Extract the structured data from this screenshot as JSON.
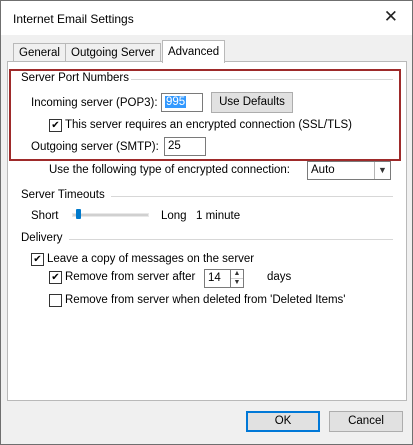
{
  "window": {
    "title": "Internet Email Settings"
  },
  "tabs": [
    {
      "label": "General"
    },
    {
      "label": "Outgoing Server"
    },
    {
      "label": "Advanced"
    }
  ],
  "server_ports": {
    "heading": "Server Port Numbers",
    "incoming_label": "Incoming server (POP3):",
    "incoming_value": "995",
    "use_defaults_label": "Use Defaults",
    "ssl_checkbox_label": "This server requires an encrypted connection (SSL/TLS)",
    "ssl_checked": true,
    "outgoing_label": "Outgoing server (SMTP):",
    "outgoing_value": "25",
    "encryption_label": "Use the following type of encrypted connection:",
    "encryption_value": "Auto"
  },
  "timeouts": {
    "heading": "Server Timeouts",
    "short_label": "Short",
    "long_label": "Long",
    "value_label": "1 minute",
    "slider_fraction": 0.08
  },
  "delivery": {
    "heading": "Delivery",
    "leave_copy_label": "Leave a copy of messages on the server",
    "leave_copy_checked": true,
    "remove_after_label": "Remove from server after",
    "remove_after_checked": true,
    "days_value": "14",
    "days_label": "days",
    "remove_deleted_label": "Remove from server when deleted from 'Deleted Items'",
    "remove_deleted_checked": false
  },
  "buttons": {
    "ok": "OK",
    "cancel": "Cancel"
  },
  "colors": {
    "highlight_box": "#9e2a2a",
    "selection": "#3399ff",
    "slider": "#007acc"
  }
}
